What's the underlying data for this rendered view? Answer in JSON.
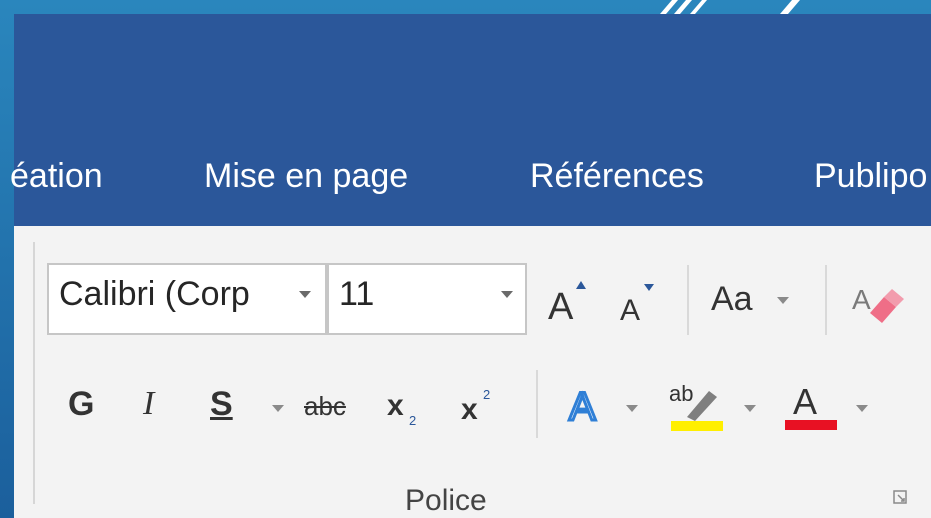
{
  "ribbon": {
    "tabs": [
      {
        "label": "éation"
      },
      {
        "label": "Mise en page"
      },
      {
        "label": "Références"
      },
      {
        "label": "Publipo"
      }
    ],
    "font": {
      "font_name": "Calibri (Corp",
      "font_size": "11",
      "change_case_label": "Aa",
      "bold_label": "G",
      "italic_label": "I",
      "underline_label": "S",
      "strikethrough_label": "abc",
      "highlight_color": "#ffef00",
      "font_color": "#e81123",
      "group_label": "Police"
    }
  },
  "colors": {
    "accent": "#2b579a",
    "slide_background": "#1f6aa8",
    "ribbon_background": "#f3f3f3"
  }
}
